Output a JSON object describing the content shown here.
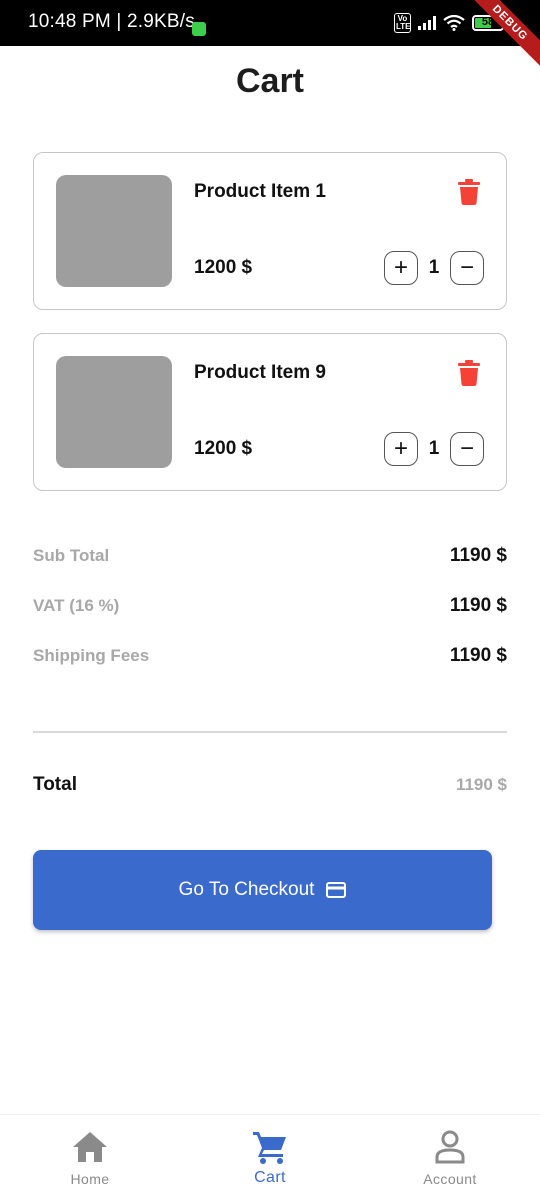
{
  "status_bar": {
    "time": "10:48 PM | 2.9KB/s",
    "network": "Vo LTE",
    "battery": "58",
    "debug_label": "DEBUG"
  },
  "page": {
    "title": "Cart"
  },
  "cart": {
    "items": [
      {
        "name": "Product Item 1",
        "price": "1200 $",
        "quantity": "1"
      },
      {
        "name": "Product Item 9",
        "price": "1200 $",
        "quantity": "1"
      }
    ],
    "plus_symbol": "+",
    "minus_symbol": "−"
  },
  "summary": {
    "subtotal_label": "Sub Total",
    "subtotal_value": "1190 $",
    "vat_label": "VAT (16 %)",
    "vat_value": "1190 $",
    "shipping_label": "Shipping Fees",
    "shipping_value": "1190 $",
    "total_label": "Total",
    "total_value": "1190 $"
  },
  "checkout": {
    "label": "Go To Checkout",
    "icon": "credit-card-icon"
  },
  "bottom_nav": {
    "items": [
      {
        "label": "Home",
        "icon": "home-icon"
      },
      {
        "label": "Cart",
        "icon": "cart-icon"
      },
      {
        "label": "Account",
        "icon": "account-icon"
      }
    ],
    "active": "Cart"
  },
  "colors": {
    "accent": "#3a6bcc",
    "delete": "#f44336",
    "muted_text": "#a8a8a8",
    "image_placeholder": "#9e9e9e"
  }
}
